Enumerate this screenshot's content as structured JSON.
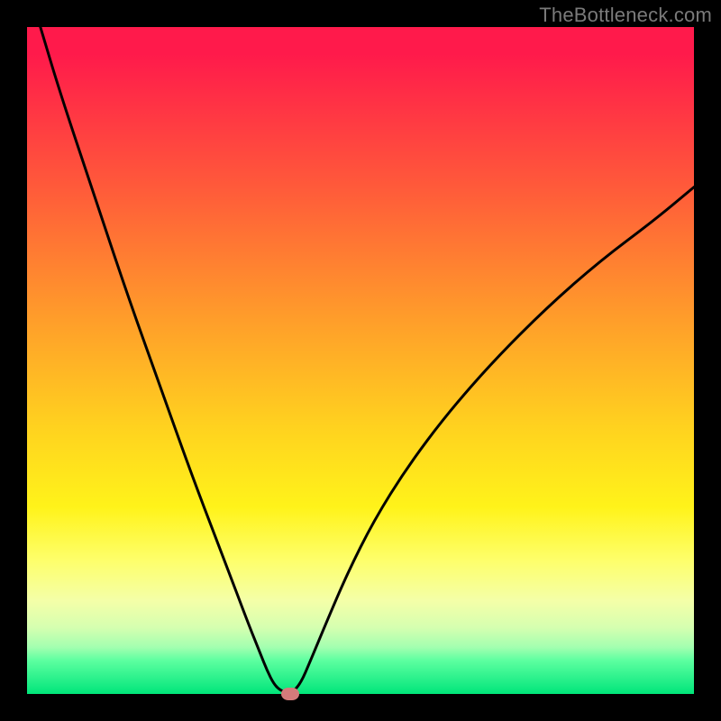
{
  "watermark": "TheBottleneck.com",
  "chart_data": {
    "type": "line",
    "title": "",
    "xlabel": "",
    "ylabel": "",
    "xlim": [
      0,
      100
    ],
    "ylim": [
      0,
      100
    ],
    "gradient_bands": [
      {
        "color": "#ff1a4b",
        "stop": 0
      },
      {
        "color": "#ff5a3a",
        "stop": 24
      },
      {
        "color": "#ff9e2a",
        "stop": 44
      },
      {
        "color": "#ffd21f",
        "stop": 60
      },
      {
        "color": "#fff31a",
        "stop": 72
      },
      {
        "color": "#feff6b",
        "stop": 80
      },
      {
        "color": "#d6ffb0",
        "stop": 90
      },
      {
        "color": "#00e57a",
        "stop": 100
      }
    ],
    "series": [
      {
        "name": "bottleneck-curve",
        "x": [
          2,
          5,
          10,
          15,
          20,
          25,
          30,
          33,
          35,
          36,
          37,
          38,
          39.5,
          41,
          42.5,
          45,
          48,
          52,
          57,
          63,
          70,
          78,
          86,
          94,
          100
        ],
        "values": [
          100,
          90,
          75,
          60,
          46,
          32,
          19,
          11,
          6,
          3.5,
          1.5,
          0.5,
          0,
          1.5,
          5,
          11,
          18,
          26,
          34,
          42,
          50,
          58,
          65,
          71,
          76
        ]
      }
    ],
    "marker": {
      "x": 39.5,
      "y": 0,
      "color": "#d47b7b"
    }
  }
}
